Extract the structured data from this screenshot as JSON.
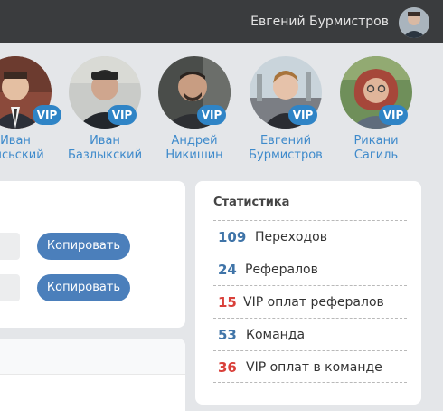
{
  "header": {
    "user_name": "Евгений Бурмистров"
  },
  "users": [
    {
      "first": "Иван",
      "last": "рисьский",
      "badge": "VIP"
    },
    {
      "first": "Иван",
      "last": "Базлыкский",
      "badge": "VIP"
    },
    {
      "first": "Андрей",
      "last": "Никишин",
      "badge": "VIP"
    },
    {
      "first": "Евгений",
      "last": "Бурмистров",
      "badge": "VIP"
    },
    {
      "first": "Рикани",
      "last": "Сагиль",
      "badge": "VIP"
    }
  ],
  "links": {
    "copy_label_1": "Копировать",
    "copy_label_2": "Копировать"
  },
  "stats": {
    "title": "Статистика",
    "rows": [
      {
        "value": "109",
        "label": "Переходов",
        "color": "#3f74a8"
      },
      {
        "value": "24",
        "label": "Рефералов",
        "color": "#3f74a8"
      },
      {
        "value": "15",
        "label": "VIP оплат рефералов",
        "color": "#d9403a"
      },
      {
        "value": "53",
        "label": "Команда",
        "color": "#3f74a8"
      },
      {
        "value": "36",
        "label": "VIP оплат в команде",
        "color": "#d9403a"
      }
    ]
  },
  "colors": {
    "accent": "#4b7fbb",
    "vip_badge": "#2f84c6",
    "name_link": "#3e8acb",
    "topbar": "#3a3c3e"
  }
}
